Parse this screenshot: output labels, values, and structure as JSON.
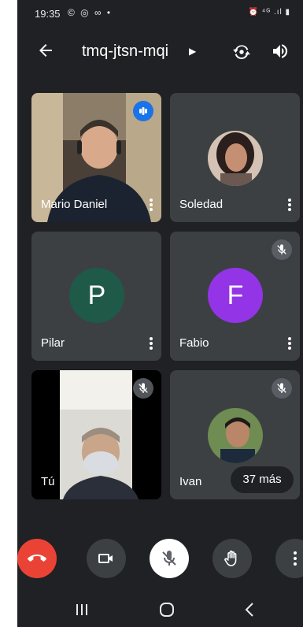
{
  "status_bar": {
    "time": "19:35",
    "left_icons": "© ◎ ∞ •",
    "right_icons": "⏰ ⁴ᴳ .ıl ▮"
  },
  "header": {
    "meeting_code": "tmq-jtsn-mqi",
    "icons": [
      "back-arrow-icon",
      "caret-right-icon",
      "switch-camera-icon",
      "speaker-icon"
    ]
  },
  "participants": [
    {
      "name": "Mario Daniel",
      "type": "video",
      "state": "speaking"
    },
    {
      "name": "Soledad",
      "type": "photo-avatar",
      "state": "normal"
    },
    {
      "name": "Pilar",
      "type": "letter-avatar",
      "letter": "P",
      "color": "#1e5a47",
      "state": "normal"
    },
    {
      "name": "Fabio",
      "type": "letter-avatar",
      "letter": "F",
      "color": "#9334e6",
      "state": "muted"
    },
    {
      "name": "Tú",
      "type": "video",
      "state": "muted"
    },
    {
      "name": "Ivan",
      "type": "photo-avatar",
      "state": "muted"
    }
  ],
  "overflow": {
    "label": "37 más"
  },
  "controls": [
    "end-call-icon",
    "camera-icon",
    "mic-off-icon",
    "raise-hand-icon",
    "more-vert-icon"
  ],
  "colors": {
    "end_call": "#ea4335",
    "accent": "#1a73e8",
    "background": "#202124",
    "tile": "#3c4043"
  }
}
